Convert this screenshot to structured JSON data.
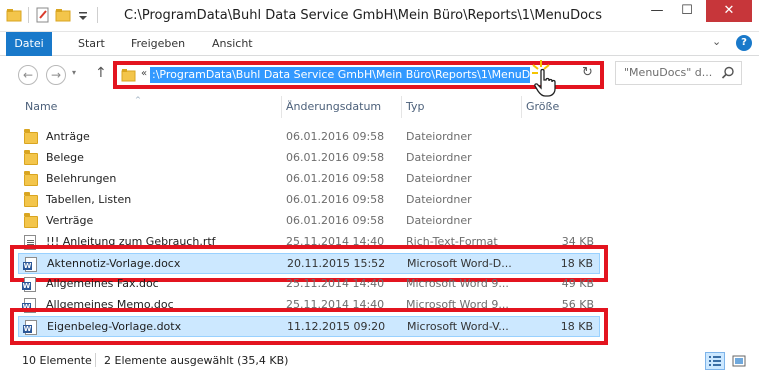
{
  "window": {
    "title": "C:\\ProgramData\\Buhl Data Service GmbH\\Mein Büro\\Reports\\1\\MenuDocs",
    "minimize": "—",
    "maximize": "☐",
    "close": "✕"
  },
  "ribbon": {
    "tabs": [
      "Datei",
      "Start",
      "Freigeben",
      "Ansicht"
    ],
    "collapse": "⌄",
    "help": "?"
  },
  "nav": {
    "back": "←",
    "forward": "→",
    "dropdown": "▾",
    "up": "↑",
    "address_prefix": "«",
    "address_path": ":\\ProgramData\\Buhl Data Service GmbH\\Mein Büro\\Reports\\1\\MenuDocs",
    "refresh": "↻",
    "search_placeholder": "\"MenuDocs\" d..."
  },
  "columns": {
    "name": "Name",
    "date": "Änderungsdatum",
    "type": "Typ",
    "size": "Größe",
    "sort_indicator": "^"
  },
  "files": [
    {
      "name": "Anträge",
      "date": "06.01.2016 09:58",
      "type": "Dateiordner",
      "size": "",
      "icon": "folder-icon",
      "selected": false
    },
    {
      "name": "Belege",
      "date": "06.01.2016 09:58",
      "type": "Dateiordner",
      "size": "",
      "icon": "folder-icon",
      "selected": false
    },
    {
      "name": "Belehrungen",
      "date": "06.01.2016 09:58",
      "type": "Dateiordner",
      "size": "",
      "icon": "folder-icon",
      "selected": false
    },
    {
      "name": "Tabellen, Listen",
      "date": "06.01.2016 09:58",
      "type": "Dateiordner",
      "size": "",
      "icon": "folder-icon",
      "selected": false
    },
    {
      "name": "Verträge",
      "date": "06.01.2016 09:58",
      "type": "Dateiordner",
      "size": "",
      "icon": "folder-icon",
      "selected": false
    },
    {
      "name": "!!! Anleitung zum Gebrauch.rtf",
      "date": "25.11.2014 14:40",
      "type": "Rich-Text-Format",
      "size": "34 KB",
      "icon": "rtf-document-icon",
      "selected": false
    },
    {
      "name": "Aktennotiz-Vorlage.docx",
      "date": "20.11.2015 15:52",
      "type": "Microsoft Word-D...",
      "size": "18 KB",
      "icon": "word-document-icon",
      "selected": true
    },
    {
      "name": "Allgemeines Fax.doc",
      "date": "25.11.2014 14:40",
      "type": "Microsoft Word 9...",
      "size": "49 KB",
      "icon": "word-document-icon",
      "selected": false
    },
    {
      "name": "Allgemeines Memo.doc",
      "date": "25.11.2014 14:40",
      "type": "Microsoft Word 9...",
      "size": "56 KB",
      "icon": "word-document-icon",
      "selected": false
    },
    {
      "name": "Eigenbeleg-Vorlage.dotx",
      "date": "11.12.2015 09:20",
      "type": "Microsoft Word-V...",
      "size": "18 KB",
      "icon": "word-template-icon",
      "selected": true
    }
  ],
  "status": {
    "count": "10 Elemente",
    "selection": "2 Elemente ausgewählt (35,4 KB)"
  },
  "colors": {
    "highlight_red": "#e3141f",
    "selection_bg": "#cce8ff",
    "file_tab": "#1979ca",
    "address_selection": "#3399ff"
  }
}
